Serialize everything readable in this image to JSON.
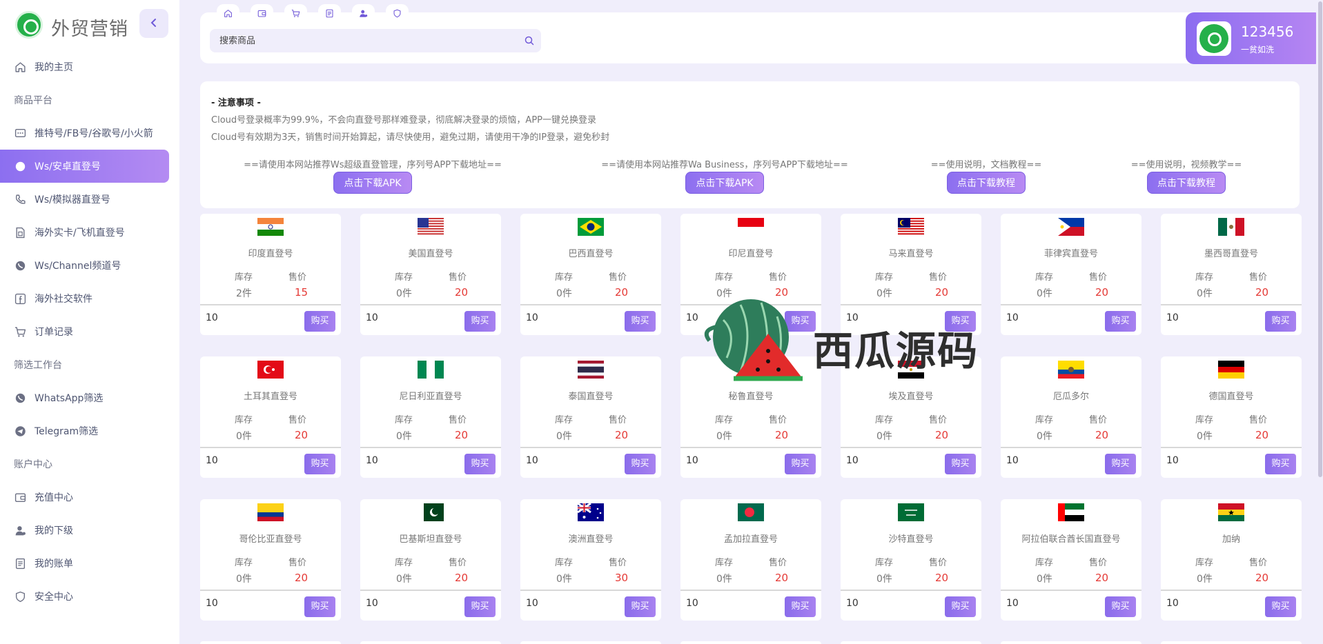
{
  "brand": {
    "title": "外贸营销",
    "collapse_icon": "chevron-left-icon"
  },
  "sidebar": {
    "items": [
      {
        "type": "item",
        "label": "我的主页",
        "icon": "home-icon"
      },
      {
        "type": "group",
        "label": "商品平台"
      },
      {
        "type": "item",
        "label": "推特号/FB号/谷歌号/小火箭",
        "icon": "message-icon"
      },
      {
        "type": "item",
        "label": "Ws/安卓直登号",
        "icon": "whatsapp-icon",
        "active": true
      },
      {
        "type": "item",
        "label": "Ws/模拟器直登号",
        "icon": "phone-icon"
      },
      {
        "type": "item",
        "label": "海外实卡/飞机直登号",
        "icon": "sim-icon"
      },
      {
        "type": "item",
        "label": "Ws/Channel频道号",
        "icon": "whatsapp-icon"
      },
      {
        "type": "item",
        "label": "海外社交软件",
        "icon": "facebook-icon"
      },
      {
        "type": "item",
        "label": "订单记录",
        "icon": "cart-icon"
      },
      {
        "type": "group",
        "label": "筛选工作台"
      },
      {
        "type": "item",
        "label": "WhatsApp筛选",
        "icon": "whatsapp-icon"
      },
      {
        "type": "item",
        "label": "Telegram筛选",
        "icon": "telegram-icon"
      },
      {
        "type": "group",
        "label": "账户中心"
      },
      {
        "type": "item",
        "label": "充值中心",
        "icon": "wallet-icon"
      },
      {
        "type": "item",
        "label": "我的下级",
        "icon": "user-icon"
      },
      {
        "type": "item",
        "label": "我的账单",
        "icon": "bill-icon"
      },
      {
        "type": "item",
        "label": "安全中心",
        "icon": "shield-icon"
      }
    ]
  },
  "topbar": {
    "nav_icons": [
      "home-icon",
      "wallet-icon",
      "cart-icon",
      "bill-icon",
      "user-icon",
      "shield-icon"
    ],
    "search_placeholder": "搜索商品",
    "search_icon": "search-icon"
  },
  "user": {
    "name": "123456",
    "subtitle": "一贫如洗"
  },
  "notice": {
    "title": "- 注意事项 -",
    "lines": [
      "Cloud号登录概率为99.9%，不会向直登号那样难登录，彻底解决登录的烦恼，APP一键兑换登录",
      "Cloud号有效期为3天，销售时间开始算起，请尽快使用，避免过期，请使用干净的IP登录，避免秒封"
    ],
    "downloads": [
      {
        "label": "==请使用本网站推荐Ws超级直登管理，序列号APP下载地址==",
        "button": "点击下载APK"
      },
      {
        "label": "==请使用本网站推荐Wa Business，序列号APP下载地址==",
        "button": "点击下载APK"
      },
      {
        "label": "==使用说明，文档教程==",
        "button": "点击下载教程"
      },
      {
        "label": "==使用说明，视频教学==",
        "button": "点击下载教程"
      }
    ]
  },
  "product_labels": {
    "stock": "库存",
    "price": "售价",
    "buy": "购买"
  },
  "products": [
    {
      "name": "印度直登号",
      "stock": "2件",
      "price": "15",
      "qty": "10",
      "flag": "in"
    },
    {
      "name": "美国直登号",
      "stock": "0件",
      "price": "20",
      "qty": "10",
      "flag": "us"
    },
    {
      "name": "巴西直登号",
      "stock": "0件",
      "price": "20",
      "qty": "10",
      "flag": "br"
    },
    {
      "name": "印尼直登号",
      "stock": "0件",
      "price": "20",
      "qty": "10",
      "flag": "id"
    },
    {
      "name": "马来直登号",
      "stock": "0件",
      "price": "20",
      "qty": "10",
      "flag": "my"
    },
    {
      "name": "菲律宾直登号",
      "stock": "0件",
      "price": "20",
      "qty": "10",
      "flag": "ph"
    },
    {
      "name": "墨西哥直登号",
      "stock": "0件",
      "price": "20",
      "qty": "10",
      "flag": "mx"
    },
    {
      "name": "土耳其直登号",
      "stock": "0件",
      "price": "20",
      "qty": "10",
      "flag": "tr"
    },
    {
      "name": "尼日利亚直登号",
      "stock": "0件",
      "price": "20",
      "qty": "10",
      "flag": "ng"
    },
    {
      "name": "泰国直登号",
      "stock": "0件",
      "price": "20",
      "qty": "10",
      "flag": "th"
    },
    {
      "name": "秘鲁直登号",
      "stock": "0件",
      "price": "20",
      "qty": "10",
      "flag": "pe"
    },
    {
      "name": "埃及直登号",
      "stock": "0件",
      "price": "20",
      "qty": "10",
      "flag": "eg"
    },
    {
      "name": "厄瓜多尔",
      "stock": "0件",
      "price": "20",
      "qty": "10",
      "flag": "ec"
    },
    {
      "name": "德国直登号",
      "stock": "0件",
      "price": "20",
      "qty": "10",
      "flag": "de"
    },
    {
      "name": "哥伦比亚直登号",
      "stock": "0件",
      "price": "20",
      "qty": "10",
      "flag": "co"
    },
    {
      "name": "巴基斯坦直登号",
      "stock": "0件",
      "price": "20",
      "qty": "10",
      "flag": "pk"
    },
    {
      "name": "澳洲直登号",
      "stock": "0件",
      "price": "30",
      "qty": "10",
      "flag": "au"
    },
    {
      "name": "孟加拉直登号",
      "stock": "0件",
      "price": "20",
      "qty": "10",
      "flag": "bd"
    },
    {
      "name": "沙特直登号",
      "stock": "0件",
      "price": "20",
      "qty": "10",
      "flag": "sa"
    },
    {
      "name": "阿拉伯联合酋长国直登号",
      "stock": "0件",
      "price": "20",
      "qty": "10",
      "flag": "ae"
    },
    {
      "name": "加纳",
      "stock": "0件",
      "price": "20",
      "qty": "10",
      "flag": "gh"
    }
  ],
  "watermark": {
    "text": "西瓜源码"
  }
}
